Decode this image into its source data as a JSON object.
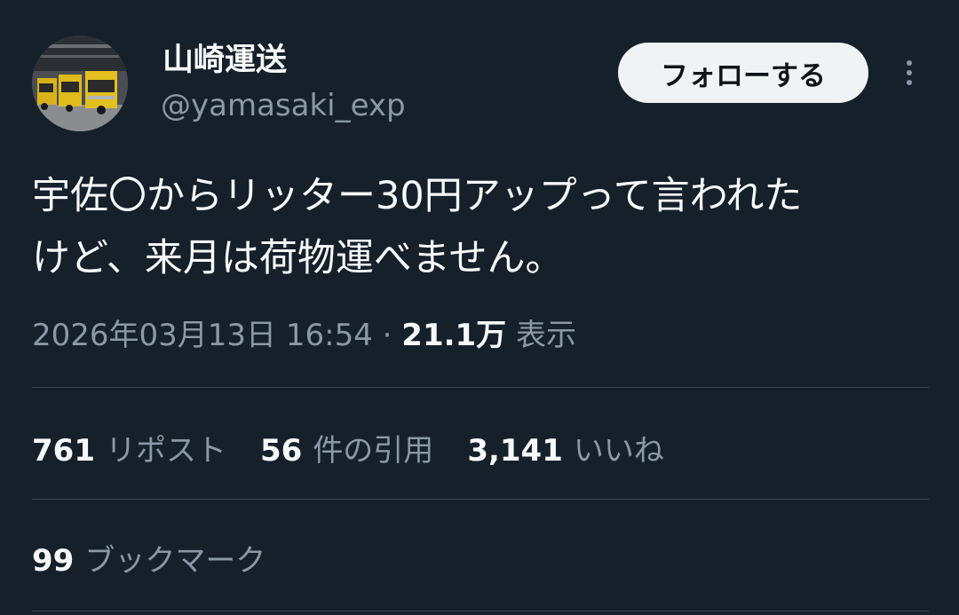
{
  "user": {
    "display_name": "山崎運送",
    "handle": "@yamasaki_exp",
    "avatar_icon": "truck-photo-avatar"
  },
  "actions": {
    "follow_label": "フォローする",
    "more_icon": "more-vertical-icon"
  },
  "tweet": {
    "lines": [
      "宇佐〇からリッター30円アップって言われた",
      "けど、来月は荷物運べません。"
    ]
  },
  "meta": {
    "timestamp": "2026年03月13日 16:54",
    "separator": "·",
    "views_count": "21.1万",
    "views_label": "表示"
  },
  "stats": {
    "reposts": {
      "count": "761",
      "label": "リポスト"
    },
    "quotes": {
      "count": "56",
      "label": "件の引用"
    },
    "likes": {
      "count": "3,141",
      "label": "いいね"
    },
    "bookmarks": {
      "count": "99",
      "label": "ブックマーク"
    }
  },
  "colors": {
    "background": "#15202b",
    "text_primary": "#f7f9f9",
    "text_secondary": "#8b98a5",
    "divider": "#38444d",
    "follow_bg": "#eff3f4"
  }
}
